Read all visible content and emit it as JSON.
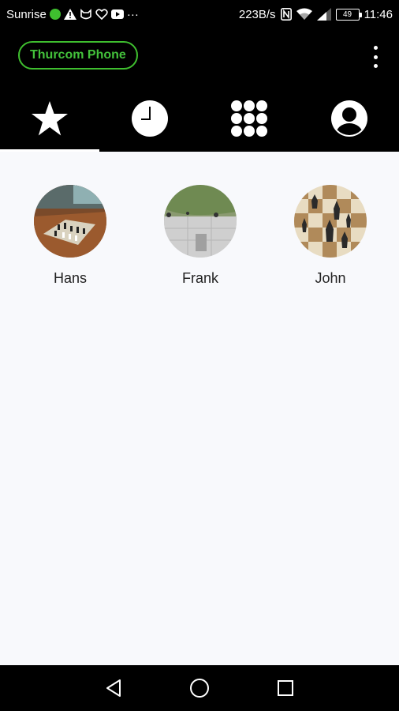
{
  "status_bar": {
    "carrier": "Sunrise",
    "more": "···",
    "network_speed": "223B/s",
    "battery_level": "49",
    "time": "11:46",
    "icons": [
      "dot-green",
      "warning-icon",
      "cat-icon",
      "heart-icon",
      "video-icon",
      "nfc-icon",
      "wifi-icon",
      "signal-icon",
      "battery-icon"
    ]
  },
  "header": {
    "carrier_button": "Thurcom Phone",
    "menu_icon": "overflow-menu-icon"
  },
  "tabs": [
    {
      "name": "favorites",
      "icon": "star-icon",
      "selected": true
    },
    {
      "name": "recents",
      "icon": "clock-icon",
      "selected": false
    },
    {
      "name": "dialpad",
      "icon": "dialpad-icon",
      "selected": false
    },
    {
      "name": "contacts",
      "icon": "person-icon",
      "selected": false
    }
  ],
  "favorites": [
    {
      "name": "Hans"
    },
    {
      "name": "Frank"
    },
    {
      "name": "John"
    }
  ],
  "nav": {
    "back_icon": "back-icon",
    "home_icon": "home-icon",
    "recents_icon": "recent-apps-icon"
  },
  "colors": {
    "accent": "#3fbf2f",
    "background": "#f8f9fc",
    "bars": "#000000"
  }
}
